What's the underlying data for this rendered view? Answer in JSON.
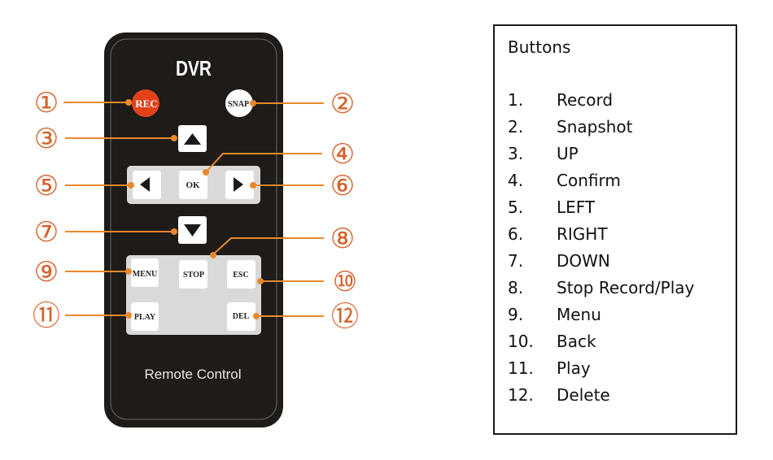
{
  "remote": {
    "brand": "DVR",
    "footer": "Remote Control",
    "body_color": "#1e1b18",
    "pad_color": "#d9d9d9",
    "accent_color": "#e8892b",
    "rec_color": "#e1421a",
    "buttons": {
      "rec": "REC",
      "snap": "SNAP",
      "up": "▲",
      "ok": "OK",
      "left": "◀",
      "right": "▶",
      "down": "▼",
      "menu": "MENU",
      "stop": "STOP",
      "esc": "ESC",
      "play": "PLAY",
      "del": "DEL"
    }
  },
  "callouts": [
    "①",
    "②",
    "③",
    "④",
    "⑤",
    "⑥",
    "⑦",
    "⑧",
    "⑨",
    "⑩",
    "⑪",
    "⑫"
  ],
  "legend": {
    "title": "Buttons",
    "items": [
      {
        "num": "1.",
        "label": "Record"
      },
      {
        "num": "2.",
        "label": "Snapshot"
      },
      {
        "num": "3.",
        "label": "UP"
      },
      {
        "num": "4.",
        "label": "Confirm"
      },
      {
        "num": "5.",
        "label": "LEFT"
      },
      {
        "num": "6.",
        "label": "RIGHT"
      },
      {
        "num": "7.",
        "label": "DOWN"
      },
      {
        "num": "8.",
        "label": "Stop Record/Play"
      },
      {
        "num": "9.",
        "label": "Menu"
      },
      {
        "num": "10.",
        "label": "Back"
      },
      {
        "num": "11.",
        "label": "Play"
      },
      {
        "num": "12.",
        "label": "Delete"
      }
    ]
  }
}
